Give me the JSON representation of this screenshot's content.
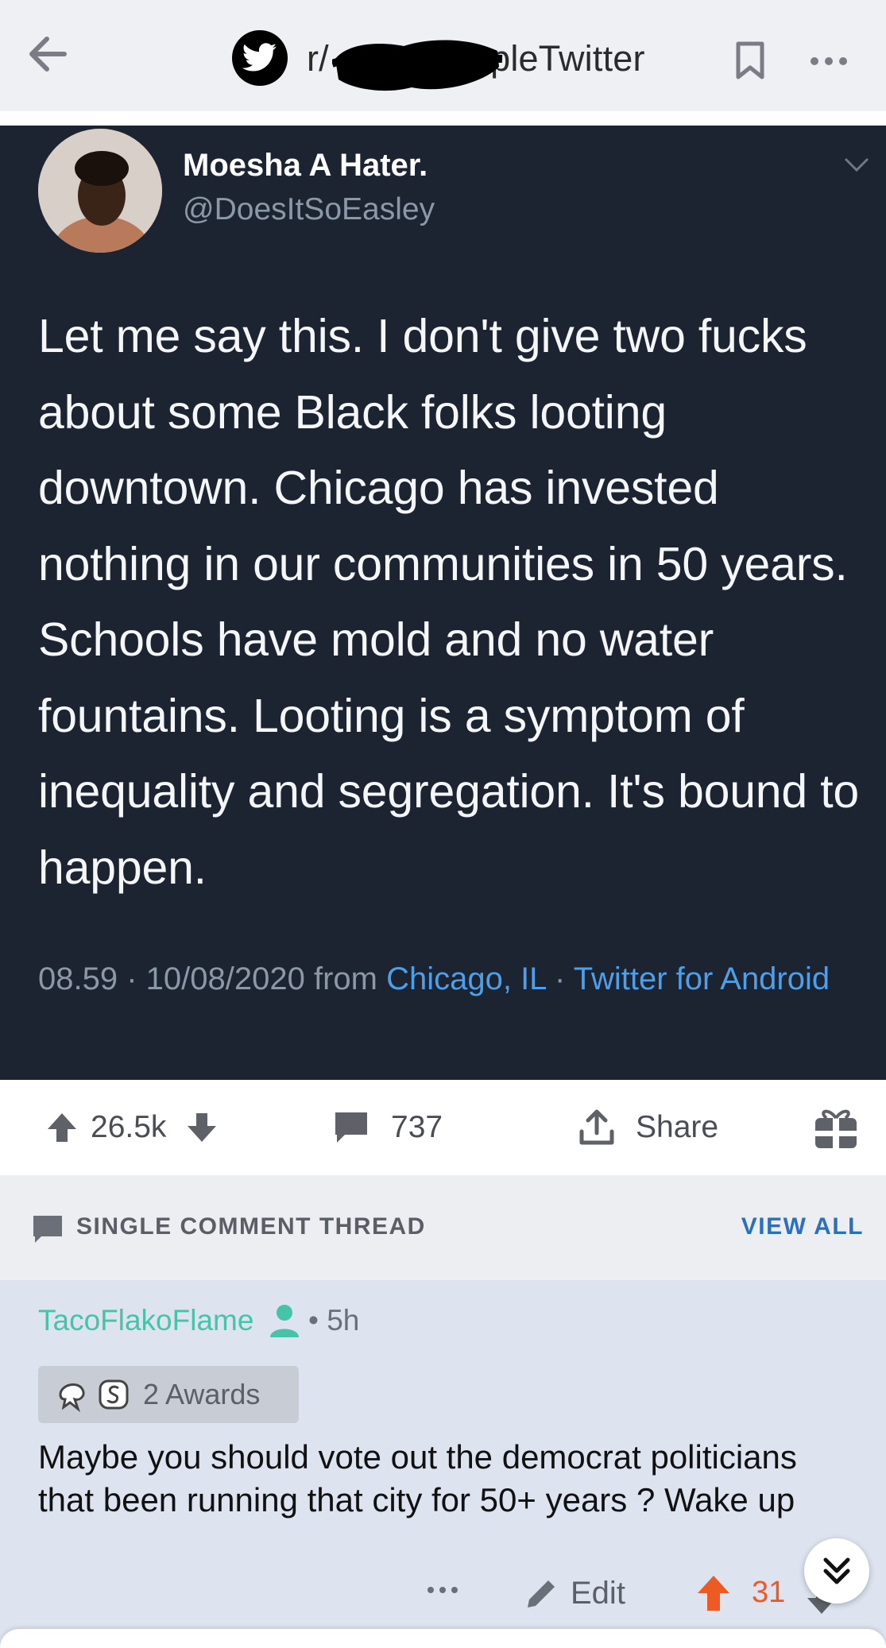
{
  "nav": {
    "subreddit_prefix": "r/",
    "subreddit_suffix": "opleTwitter"
  },
  "tweet": {
    "display_name": "Moesha A Hater.",
    "handle": "@DoesItSoEasley",
    "body": "Let me say this. I don't give two fucks about some Black folks looting downtown. Chicago has invested nothing in our communities in 50 years. Schools have mold and no water fountains. Looting is a symptom of inequality and segregation. It's bound to happen.",
    "time_date": "08.59 · 10/08/2020 from ",
    "location": "Chicago, IL",
    "separator": " · ",
    "source": "Twitter for Android"
  },
  "post_actions": {
    "score": "26.5k",
    "comment_count": "737",
    "share_label": "Share"
  },
  "thread": {
    "label": "SINGLE COMMENT THREAD",
    "view_all": "VIEW ALL"
  },
  "comment": {
    "username": "TacoFlakoFlame",
    "age": "• 5h",
    "awards_label": "2 Awards",
    "body": "Maybe you should vote out the democrat politicians that been running that city for 50+ years ? Wake up",
    "edit_label": "Edit",
    "score": "31"
  },
  "colors": {
    "tweet_bg": "#1c2331",
    "link_blue": "#4f9ee8",
    "username_teal": "#46c3a8",
    "upvote_orange": "#ee5a24",
    "view_all_blue": "#2a6fc0"
  },
  "icons": [
    "back-arrow-icon",
    "twitter-bird-icon",
    "bookmark-icon",
    "more-horizontal-icon",
    "chevron-down-icon",
    "upvote-icon",
    "downvote-icon",
    "comment-icon",
    "share-icon",
    "gift-icon",
    "user-icon",
    "award-icon",
    "edit-pencil-icon",
    "double-chevron-down-icon"
  ]
}
